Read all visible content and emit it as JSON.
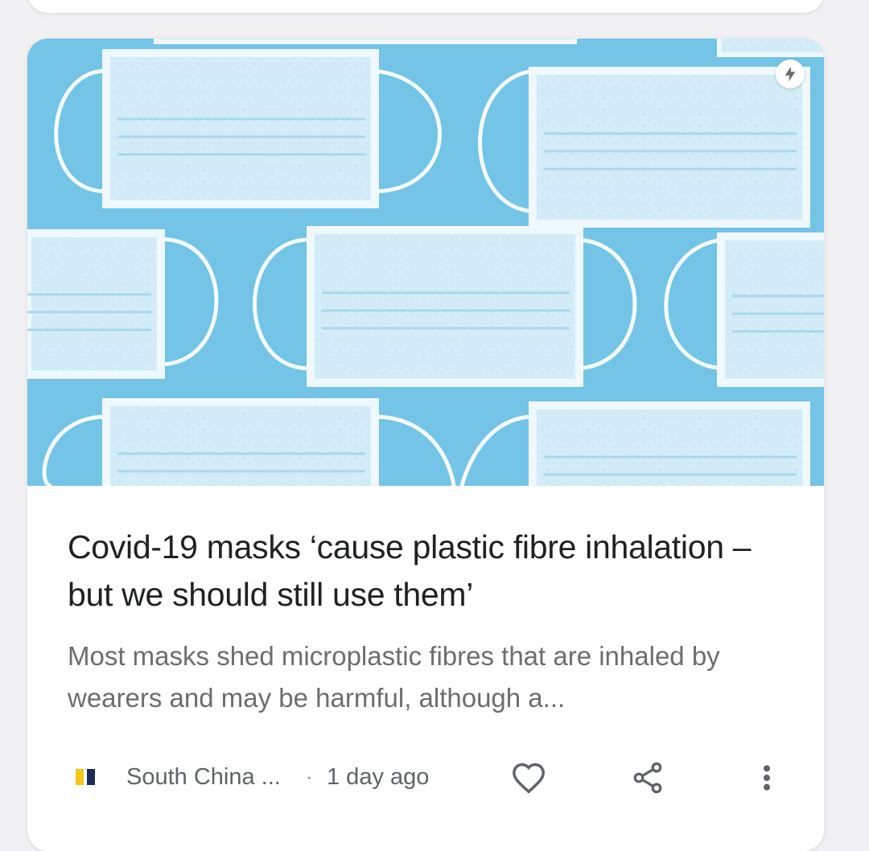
{
  "article": {
    "title": "Covid-19 masks ‘cause plastic fibre inhalation – but we should still use them’",
    "snippet": "Most masks shed microplastic fibres that are inhaled by wearers and may be harmful, although a...",
    "publisher": "South China ...",
    "separator": "·",
    "age": "1 day ago",
    "image_icon": "amp-lightning-icon",
    "publisher_logo_colors": [
      "#f5c518",
      "#1f2a5a"
    ]
  },
  "actions": {
    "like_icon": "heart-icon",
    "share_icon": "share-icon",
    "more_icon": "more-vert-icon"
  },
  "colors": {
    "card_bg": "#ffffff",
    "page_bg": "#f1f1f3",
    "title": "#202124",
    "snippet": "#6c6d70",
    "meta": "#5f6368",
    "image_bg": "#73c4e6"
  }
}
